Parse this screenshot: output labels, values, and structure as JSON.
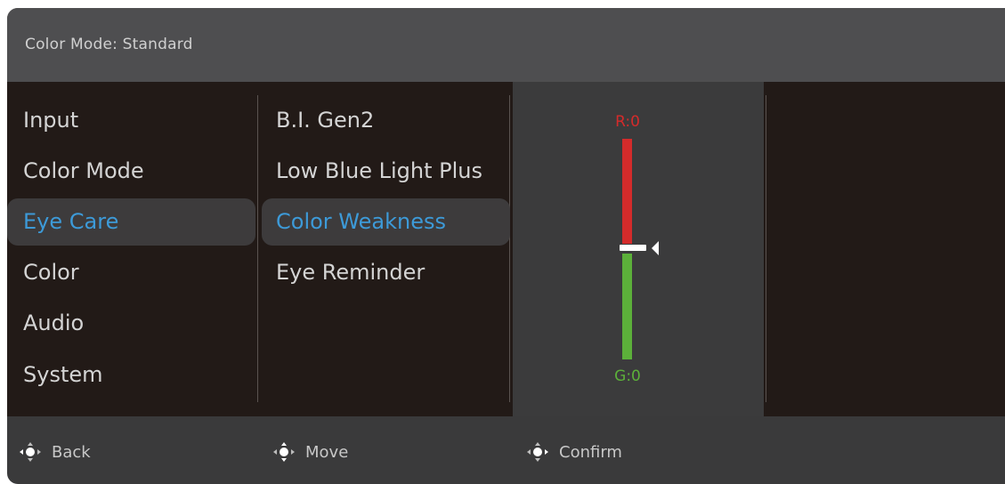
{
  "header": {
    "title": "Color Mode: Standard"
  },
  "main_menu": {
    "items": [
      {
        "label": "Input",
        "selected": false
      },
      {
        "label": "Color Mode",
        "selected": false
      },
      {
        "label": "Eye Care",
        "selected": true
      },
      {
        "label": "Color",
        "selected": false
      },
      {
        "label": "Audio",
        "selected": false
      },
      {
        "label": "System",
        "selected": false
      }
    ]
  },
  "sub_menu": {
    "items": [
      {
        "label": "B.I. Gen2",
        "selected": false
      },
      {
        "label": "Low Blue Light Plus",
        "selected": false
      },
      {
        "label": "Color Weakness",
        "selected": true
      },
      {
        "label": "Eye Reminder",
        "selected": false
      }
    ]
  },
  "color_weakness_slider": {
    "top_label": "R:0",
    "bottom_label": "G:0",
    "level_fraction": 0.5,
    "top_color": "#d42b2b",
    "bottom_color": "#5cb03a"
  },
  "footer": {
    "back_label": "Back",
    "move_label": "Move",
    "confirm_label": "Confirm",
    "icon": "joystick-icon"
  },
  "colors": {
    "accent": "#3d9ad8",
    "text": "#d4d4d4",
    "panel": "#221a17",
    "header": "#4e4e50"
  }
}
